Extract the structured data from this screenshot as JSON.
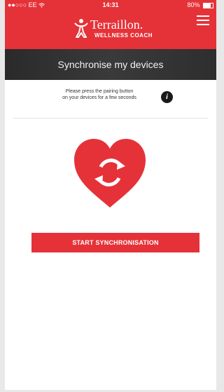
{
  "status_bar": {
    "carrier": "●●○○○ EE",
    "wifi_icon": "wifi-icon",
    "time": "14:31",
    "battery_percent_label": "80%",
    "battery_level": 0.8
  },
  "header": {
    "brand_title": "Terraillon.",
    "brand_subtitle": "WELLNESS COACH",
    "menu_icon": "hamburger-menu-icon",
    "background_color": "#e53238"
  },
  "banner": {
    "title": "Synchronise my devices"
  },
  "hint": {
    "line1": "Please press the pairing button",
    "line2": "on your devices for a few seconds",
    "info_icon_glyph": "i"
  },
  "illustration": {
    "icon": "heart-sync-icon",
    "color": "#e53238"
  },
  "actions": {
    "start_sync_label": "START SYNCHRONISATION"
  }
}
